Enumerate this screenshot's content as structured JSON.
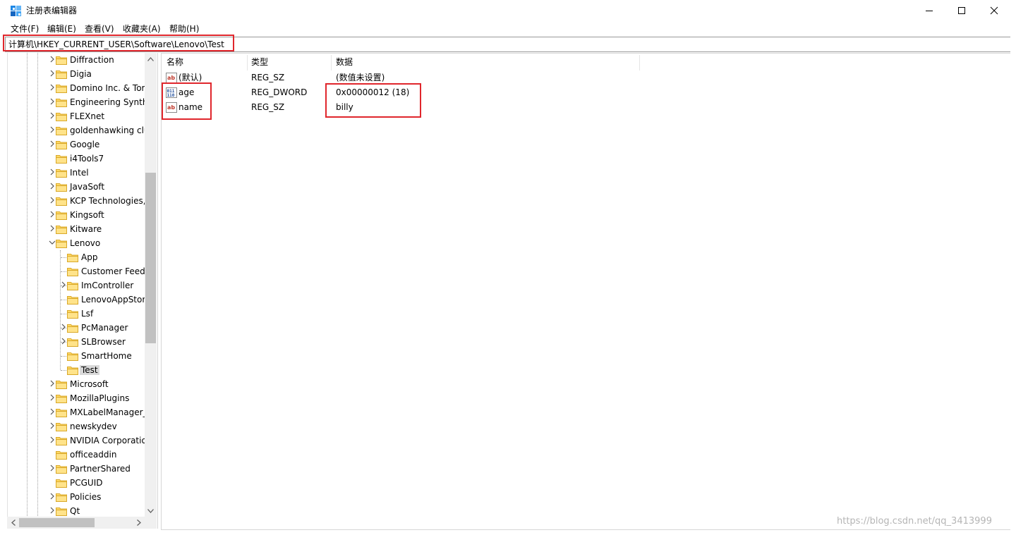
{
  "window": {
    "title": "注册表编辑器",
    "accent": "#0078d7"
  },
  "menu": [
    "文件(F)",
    "编辑(E)",
    "查看(V)",
    "收藏夹(A)",
    "帮助(H)"
  ],
  "address": "计算机\\HKEY_CURRENT_USER\\Software\\Lenovo\\Test",
  "tree": {
    "nodes": [
      {
        "label": "Diffraction",
        "level": 1,
        "expander": "collapsed"
      },
      {
        "label": "Digia",
        "level": 1,
        "expander": "collapsed"
      },
      {
        "label": "Domino Inc. & Tor",
        "level": 1,
        "expander": "collapsed"
      },
      {
        "label": "Engineering Synthe",
        "level": 1,
        "expander": "collapsed"
      },
      {
        "label": "FLEXnet",
        "level": 1,
        "expander": "collapsed"
      },
      {
        "label": "goldenhawking clu",
        "level": 1,
        "expander": "collapsed"
      },
      {
        "label": "Google",
        "level": 1,
        "expander": "collapsed"
      },
      {
        "label": "i4Tools7",
        "level": 1,
        "expander": "none"
      },
      {
        "label": "Intel",
        "level": 1,
        "expander": "collapsed"
      },
      {
        "label": "JavaSoft",
        "level": 1,
        "expander": "collapsed"
      },
      {
        "label": "KCP Technologies,",
        "level": 1,
        "expander": "collapsed"
      },
      {
        "label": "Kingsoft",
        "level": 1,
        "expander": "collapsed"
      },
      {
        "label": "Kitware",
        "level": 1,
        "expander": "collapsed"
      },
      {
        "label": "Lenovo",
        "level": 1,
        "expander": "expanded"
      },
      {
        "label": "App",
        "level": 2,
        "expander": "none"
      },
      {
        "label": "Customer Feedb",
        "level": 2,
        "expander": "none"
      },
      {
        "label": "ImController",
        "level": 2,
        "expander": "collapsed"
      },
      {
        "label": "LenovoAppStor",
        "level": 2,
        "expander": "none"
      },
      {
        "label": "Lsf",
        "level": 2,
        "expander": "none"
      },
      {
        "label": "PcManager",
        "level": 2,
        "expander": "collapsed"
      },
      {
        "label": "SLBrowser",
        "level": 2,
        "expander": "collapsed"
      },
      {
        "label": "SmartHome",
        "level": 2,
        "expander": "none"
      },
      {
        "label": "Test",
        "level": 2,
        "expander": "none",
        "selected": true
      },
      {
        "label": "Microsoft",
        "level": 1,
        "expander": "collapsed"
      },
      {
        "label": "MozillaPlugins",
        "level": 1,
        "expander": "collapsed"
      },
      {
        "label": "MXLabelManager_",
        "level": 1,
        "expander": "collapsed"
      },
      {
        "label": "newskydev",
        "level": 1,
        "expander": "collapsed"
      },
      {
        "label": "NVIDIA Corporatio",
        "level": 1,
        "expander": "collapsed"
      },
      {
        "label": "officeaddin",
        "level": 1,
        "expander": "none"
      },
      {
        "label": "PartnerShared",
        "level": 1,
        "expander": "collapsed"
      },
      {
        "label": "PCGUID",
        "level": 1,
        "expander": "none"
      },
      {
        "label": "Policies",
        "level": 1,
        "expander": "collapsed"
      },
      {
        "label": "Qt",
        "level": 1,
        "expander": "collapsed"
      }
    ]
  },
  "values": {
    "columns": {
      "name": "名称",
      "type": "类型",
      "data": "数据"
    },
    "rows": [
      {
        "icon": "string-value-icon",
        "name": "(默认)",
        "type": "REG_SZ",
        "data": "(数值未设置)"
      },
      {
        "icon": "dword-value-icon",
        "name": "age",
        "type": "REG_DWORD",
        "data": "0x00000012 (18)"
      },
      {
        "icon": "string-value-icon",
        "name": "name",
        "type": "REG_SZ",
        "data": "billy"
      }
    ]
  },
  "watermark": "https://blog.csdn.net/qq_3413999",
  "highlight_color": "#e0262c"
}
